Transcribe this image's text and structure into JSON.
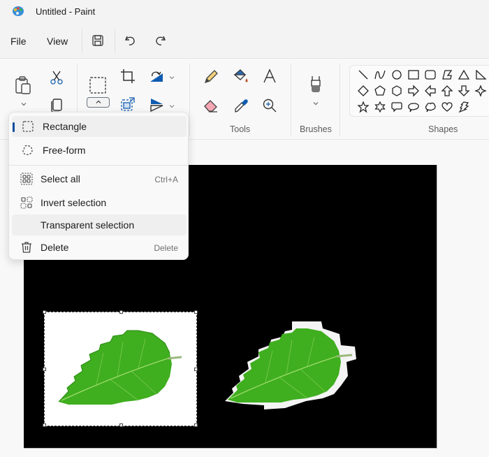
{
  "titlebar": {
    "title": "Untitled - Paint",
    "app_icon": "paint-palette-icon"
  },
  "menubar": {
    "items": [
      {
        "label": "File"
      },
      {
        "label": "View"
      }
    ],
    "quick_actions": [
      {
        "icon": "save-icon"
      },
      {
        "icon": "undo-icon"
      },
      {
        "icon": "redo-icon"
      }
    ]
  },
  "ribbon": {
    "clipboard": {
      "icons": [
        "paste-icon",
        "cut-icon",
        "copy-icon"
      ]
    },
    "image": {
      "icons": [
        "rectangle-select-icon",
        "crop-icon",
        "resize-icon",
        "rotate-icon",
        "flip-icon"
      ]
    },
    "tools": {
      "label": "Tools",
      "icons": [
        "pencil-icon",
        "fill-icon",
        "text-icon",
        "eraser-icon",
        "color-picker-icon",
        "magnifier-icon"
      ]
    },
    "brushes": {
      "label": "Brushes"
    },
    "shapes": {
      "label": "Shapes",
      "items": [
        "line",
        "curve",
        "oval",
        "rectangle",
        "rounded-rectangle",
        "polygon",
        "triangle",
        "right-triangle",
        "diamond",
        "pentagon",
        "hexagon",
        "right-arrow",
        "left-arrow",
        "up-arrow",
        "down-arrow",
        "four-point-star",
        "five-point-star",
        "six-point-star",
        "rounded-callout",
        "oval-callout",
        "cloud-callout",
        "heart",
        "lightning"
      ]
    }
  },
  "selection_menu": {
    "items": [
      {
        "label": "Rectangle",
        "shortcut": "",
        "icon": "rectangle-select-icon",
        "selected": true
      },
      {
        "label": "Free-form",
        "shortcut": "",
        "icon": "freeform-select-icon",
        "selected": false
      },
      {
        "label": "Select all",
        "shortcut": "Ctrl+A",
        "icon": "select-all-icon",
        "selected": false
      },
      {
        "label": "Invert selection",
        "shortcut": "",
        "icon": "invert-selection-icon",
        "selected": false
      },
      {
        "label": "Transparent selection",
        "shortcut": "",
        "icon": "",
        "selected": false
      },
      {
        "label": "Delete",
        "shortcut": "Delete",
        "icon": "trash-icon",
        "selected": false
      }
    ]
  },
  "colors": {
    "accent": "#0f4c9c",
    "canvas_bg": "#000000",
    "leaf": "#3fae1f"
  }
}
